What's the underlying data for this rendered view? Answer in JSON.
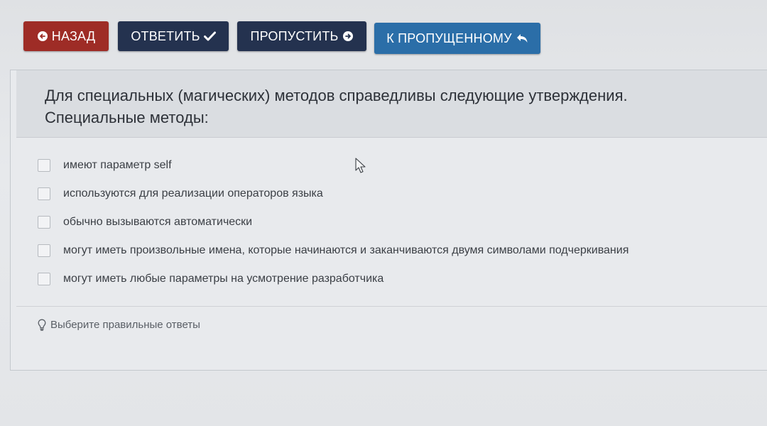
{
  "toolbar": {
    "back": {
      "label": "НАЗАД",
      "icon": "circle-back-icon",
      "color": "#9e2c26"
    },
    "answer": {
      "label": "ОТВЕТИТЬ",
      "icon": "check-icon",
      "color": "#24324f"
    },
    "skip": {
      "label": "ПРОПУСТИТЬ",
      "icon": "circle-forward-icon",
      "color": "#24324f"
    },
    "to_skipped": {
      "label": "К ПРОПУЩЕННОМУ",
      "icon": "reply-arrow-icon",
      "color": "#2b6ea8"
    }
  },
  "question": {
    "text": "Для специальных (магических) методов справедливы следующие утверждения. Специальные методы:"
  },
  "options": [
    {
      "label": "имеют параметр self",
      "checked": false
    },
    {
      "label": "используются для реализации операторов языка",
      "checked": false
    },
    {
      "label": "обычно вызываются автоматически",
      "checked": false
    },
    {
      "label": "могут иметь произвольные имена, которые начинаются и заканчиваются двумя символами подчеркивания",
      "checked": false
    },
    {
      "label": "могут иметь любые параметры на усмотрение разработчика",
      "checked": false
    }
  ],
  "hint": {
    "icon": "lightbulb-icon",
    "text": "Выберите правильные ответы"
  }
}
